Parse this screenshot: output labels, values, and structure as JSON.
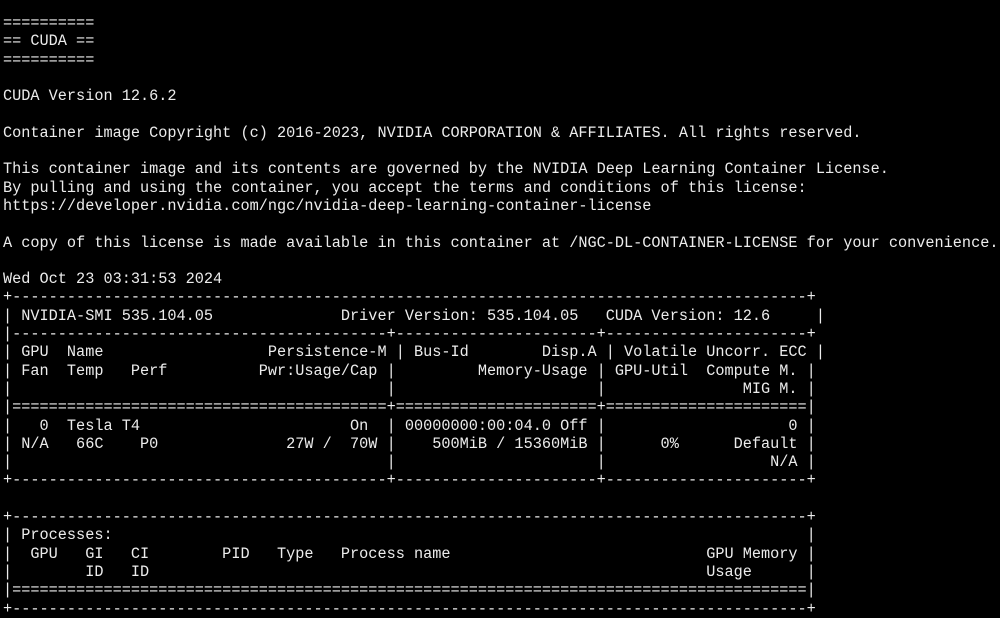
{
  "theme": {
    "background": "#000000",
    "foreground": "#ececec"
  },
  "terminal": {
    "lines": [
      "==========",
      "== CUDA ==",
      "==========",
      "",
      "CUDA Version 12.6.2",
      "",
      "Container image Copyright (c) 2016-2023, NVIDIA CORPORATION & AFFILIATES. All rights reserved.",
      "",
      "This container image and its contents are governed by the NVIDIA Deep Learning Container License.",
      "By pulling and using the container, you accept the terms and conditions of this license:",
      "https://developer.nvidia.com/ngc/nvidia-deep-learning-container-license",
      "",
      "A copy of this license is made available in this container at /NGC-DL-CONTAINER-LICENSE for your convenience.",
      "",
      "Wed Oct 23 03:31:53 2024",
      "+---------------------------------------------------------------------------------------+",
      "| NVIDIA-SMI 535.104.05              Driver Version: 535.104.05   CUDA Version: 12.6     |",
      "|-----------------------------------------+----------------------+----------------------+",
      "| GPU  Name                  Persistence-M | Bus-Id        Disp.A | Volatile Uncorr. ECC |",
      "| Fan  Temp   Perf          Pwr:Usage/Cap |         Memory-Usage | GPU-Util  Compute M. |",
      "|                                         |                      |               MIG M. |",
      "|=========================================+======================+======================|",
      "|   0  Tesla T4                       On  | 00000000:00:04.0 Off |                    0 |",
      "| N/A   66C    P0              27W /  70W |    500MiB / 15360MiB |      0%      Default |",
      "|                                         |                      |                  N/A |",
      "+-----------------------------------------+----------------------+----------------------+",
      "",
      "+---------------------------------------------------------------------------------------+",
      "| Processes:                                                                            |",
      "|  GPU   GI   CI        PID   Type   Process name                            GPU Memory |",
      "|        ID   ID                                                             Usage      |",
      "|=======================================================================================|",
      "+---------------------------------------------------------------------------------------+"
    ]
  }
}
